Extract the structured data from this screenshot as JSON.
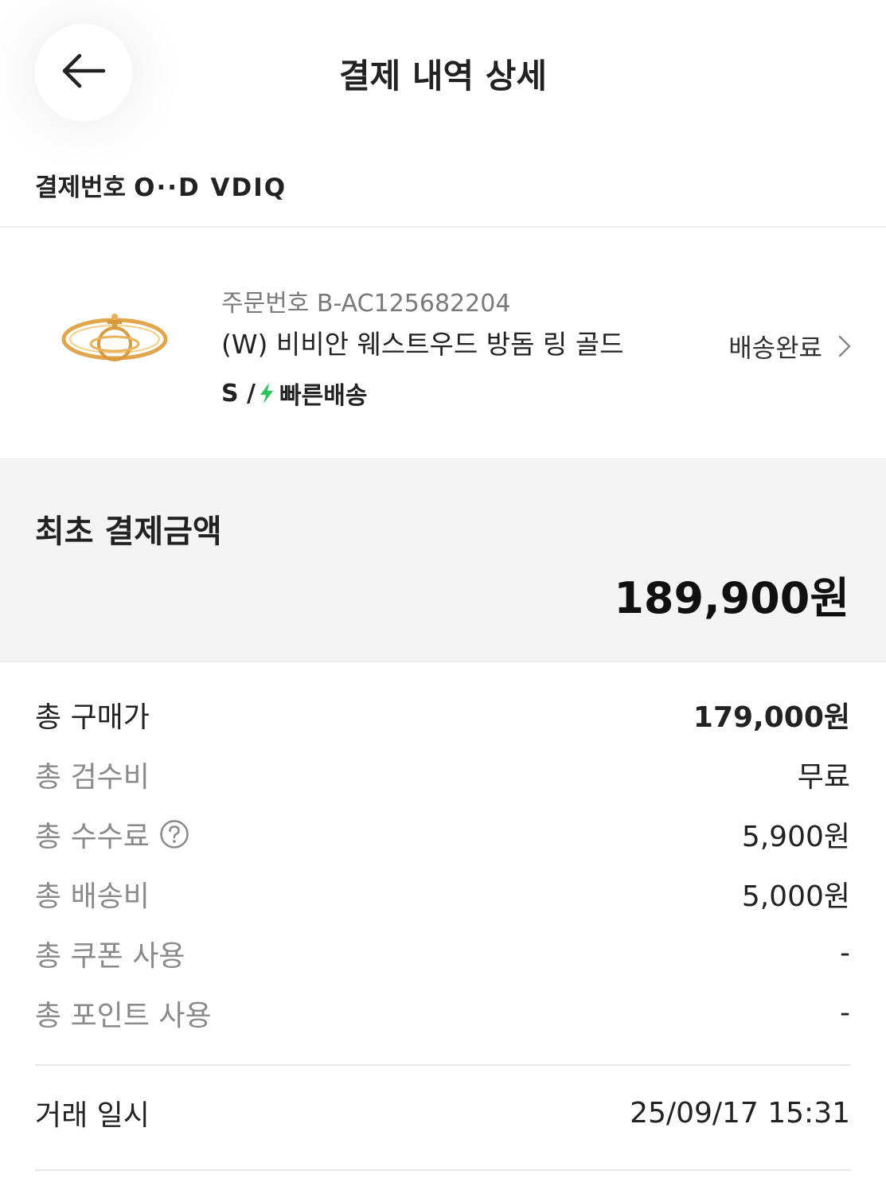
{
  "header": {
    "title": "결제 내역 상세",
    "payment_label": "결제번호",
    "payment_value": "O··D VDIQ"
  },
  "product": {
    "order_no": "주문번호 B-AC125682204",
    "name": "(W) 비비안 웨스트우드 방돔 링 골드",
    "size": "S /",
    "shipping": "빠른배송",
    "status": "배송완료",
    "bolt_color": "#31c45a"
  },
  "summary": {
    "label": "최초 결제금액",
    "amount": "189,900원"
  },
  "details": [
    {
      "label": "총 구매가",
      "value": "179,000원"
    },
    {
      "label": "총 검수비",
      "value": "무료"
    },
    {
      "label": "총 수수료",
      "value": "5,900원"
    },
    {
      "label": "총 배송비",
      "value": "5,000원"
    },
    {
      "label": "총 쿠폰 사용",
      "value": "-"
    },
    {
      "label": "총 포인트 사용",
      "value": "-"
    }
  ],
  "transaction": {
    "label": "거래 일시",
    "value": "25/09/17 15:31"
  }
}
